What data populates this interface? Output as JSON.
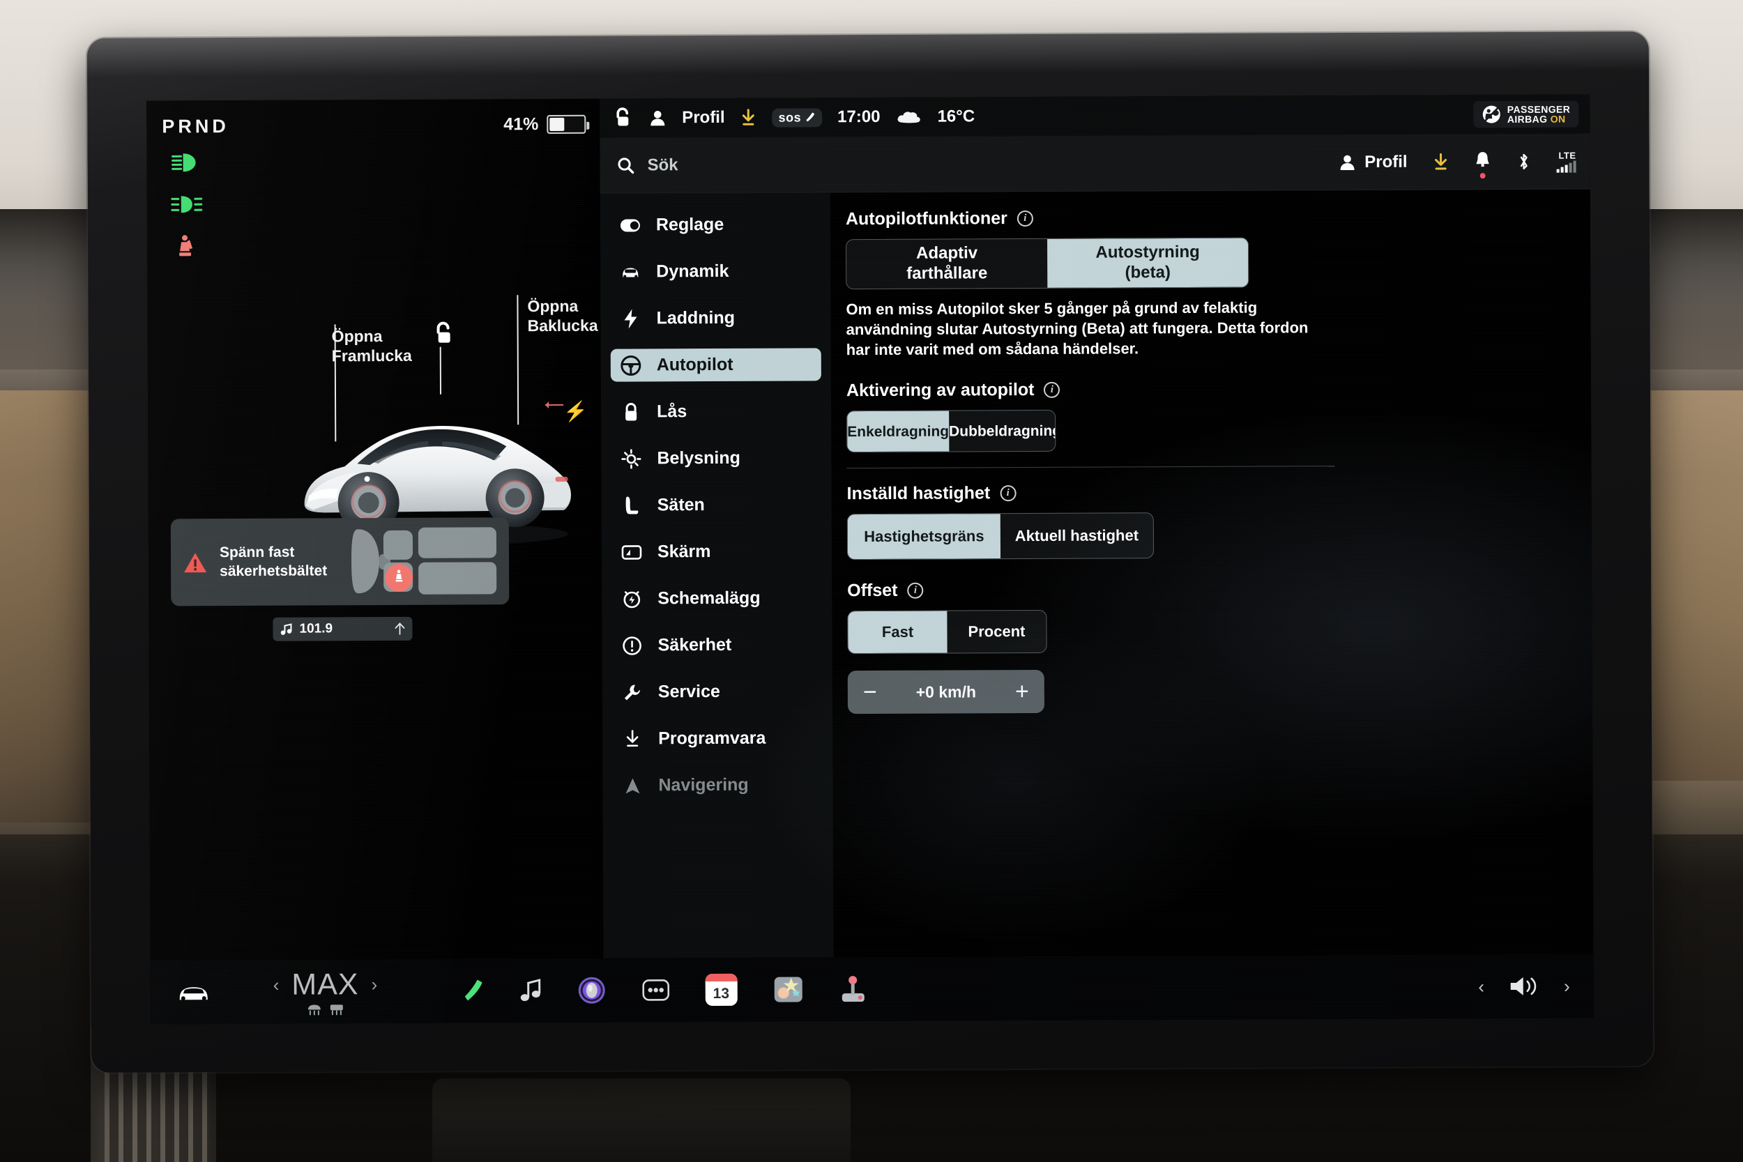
{
  "driving": {
    "gear_indicator": "PRND",
    "battery_percent": "41%",
    "battery_level": 41,
    "telltales": [
      {
        "name": "high-beam-telltale",
        "color": "#3ddc6e"
      },
      {
        "name": "fog-light-telltale",
        "color": "#3ddc6e"
      },
      {
        "name": "seatbelt-telltale",
        "color": "#f07a74"
      }
    ],
    "labels": {
      "front_trunk": "Öppna\nFramlucka",
      "front_trunk_line1": "Öppna",
      "front_trunk_line2": "Framlucka",
      "rear_trunk_line1": "Öppna",
      "rear_trunk_line2": "Baklucka"
    },
    "alert": {
      "line1": "Spänn fast",
      "line2": "säkerhetsbältet"
    },
    "radio": {
      "frequency": "101.9"
    }
  },
  "statusbar": {
    "profile_label": "Profil",
    "sos_label": "sos",
    "time": "17:00",
    "temperature": "16°C",
    "airbag_line1": "PASSENGER",
    "airbag_line2": "AIRBAG",
    "airbag_state": "ON"
  },
  "search": {
    "placeholder": "Sök",
    "profile_label": "Profil",
    "network_label": "LTE"
  },
  "sidebar": {
    "items": [
      {
        "label": "Reglage",
        "icon": "toggle-icon",
        "active": false,
        "dim": false
      },
      {
        "label": "Dynamik",
        "icon": "car-front-icon",
        "active": false,
        "dim": false
      },
      {
        "label": "Laddning",
        "icon": "bolt-icon",
        "active": false,
        "dim": false
      },
      {
        "label": "Autopilot",
        "icon": "steering-wheel-icon",
        "active": true,
        "dim": false
      },
      {
        "label": "Lås",
        "icon": "lock-icon",
        "active": false,
        "dim": false
      },
      {
        "label": "Belysning",
        "icon": "sun-icon",
        "active": false,
        "dim": false
      },
      {
        "label": "Säten",
        "icon": "seat-icon",
        "active": false,
        "dim": false
      },
      {
        "label": "Skärm",
        "icon": "display-icon",
        "active": false,
        "dim": false
      },
      {
        "label": "Schemalägg",
        "icon": "alarm-icon",
        "active": false,
        "dim": false
      },
      {
        "label": "Säkerhet",
        "icon": "exclamation-circle-icon",
        "active": false,
        "dim": false
      },
      {
        "label": "Service",
        "icon": "wrench-icon",
        "active": false,
        "dim": false
      },
      {
        "label": "Programvara",
        "icon": "download-icon",
        "active": false,
        "dim": false
      },
      {
        "label": "Navigering",
        "icon": "navigation-arrow-icon",
        "active": false,
        "dim": true
      }
    ]
  },
  "autopilot": {
    "features": {
      "title": "Autopilotfunktioner",
      "option_a_line1": "Adaptiv",
      "option_a_line2": "farthållare",
      "option_b_line1": "Autostyrning",
      "option_b_line2": "(beta)",
      "selected": "option_b",
      "description": "Om en miss Autopilot sker 5 gånger på grund av felaktig användning slutar Autostyrning (Beta) att fungera. Detta fordon har inte varit med om sådana händelser."
    },
    "activation": {
      "title": "Aktivering av autopilot",
      "option_a": "Enkeldragning",
      "option_b": "Dubbeldragning",
      "selected": "option_a"
    },
    "set_speed": {
      "title": "Inställd hastighet",
      "option_a": "Hastighetsgräns",
      "option_b": "Aktuell hastighet",
      "selected": "option_a"
    },
    "offset": {
      "title": "Offset",
      "option_a": "Fast",
      "option_b": "Procent",
      "selected": "option_a",
      "value": "+0 km/h",
      "minus": "−",
      "plus": "+"
    }
  },
  "dock": {
    "climate_value": "MAX",
    "prev_chevron": "‹",
    "next_chevron": "›",
    "vol_prev": "‹",
    "vol_next": "›",
    "calendar_day": "13",
    "apps": [
      {
        "name": "phone-icon"
      },
      {
        "name": "music-note-icon"
      },
      {
        "name": "media-dial-icon"
      },
      {
        "name": "more-dots-icon"
      },
      {
        "name": "calendar-icon"
      },
      {
        "name": "photos-icon"
      },
      {
        "name": "arcade-joystick-icon"
      }
    ]
  },
  "colors": {
    "accent_selected": "#c2d4d8",
    "telltale_green": "#3ddc6e",
    "telltale_red": "#f07a74",
    "warning_red": "#f0554f",
    "download_yellow": "#e8c23c",
    "airbag_on": "#e8b93a"
  }
}
